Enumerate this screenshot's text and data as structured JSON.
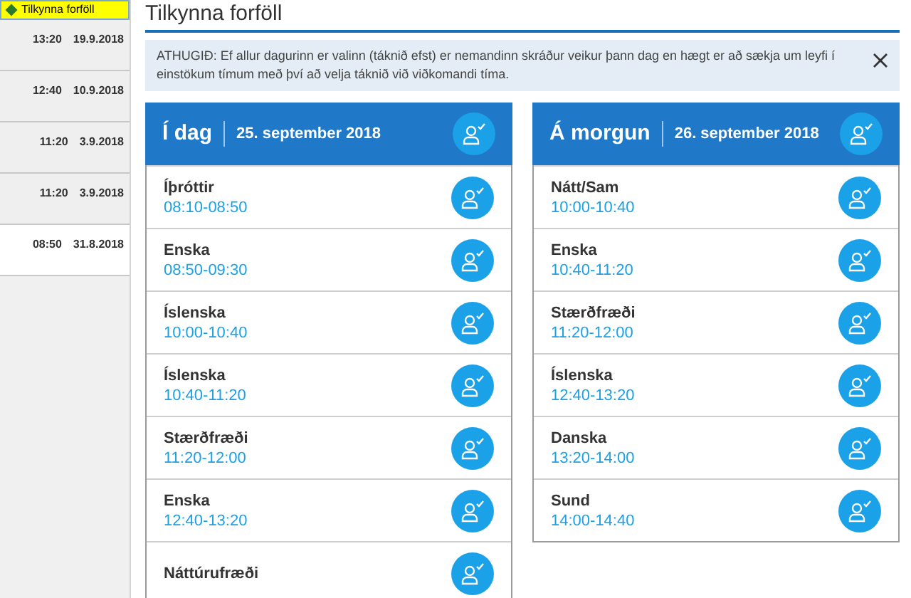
{
  "sidebar": {
    "active_item": "Tilkynna forföll",
    "items": [
      {
        "time": "13:20",
        "date": "19.9.2018",
        "highlighted": true
      },
      {
        "time": "12:40",
        "date": "10.9.2018",
        "highlighted": true
      },
      {
        "time": "11:20",
        "date": "3.9.2018",
        "highlighted": true
      },
      {
        "time": "11:20",
        "date": "3.9.2018",
        "highlighted": true
      },
      {
        "time": "08:50",
        "date": "31.8.2018",
        "highlighted": false
      }
    ]
  },
  "page_title": "Tilkynna forföll",
  "notice": {
    "text": "ATHUGIÐ: Ef allur dagurinn er valinn (táknið efst) er nemandinn skráður veikur þann dag en hægt er að sækja um leyfi í einstökum tímum með því að velja táknið við viðkomandi tíma."
  },
  "days": [
    {
      "label": "Í dag",
      "date": "25. september 2018",
      "classes": [
        {
          "subject": "Íþróttir",
          "time": "08:10-08:50"
        },
        {
          "subject": "Enska",
          "time": "08:50-09:30"
        },
        {
          "subject": "Íslenska",
          "time": "10:00-10:40"
        },
        {
          "subject": "Íslenska",
          "time": "10:40-11:20"
        },
        {
          "subject": "Stærðfræði",
          "time": "11:20-12:00"
        },
        {
          "subject": "Enska",
          "time": "12:40-13:20"
        },
        {
          "subject": "Náttúrufræði"
        }
      ]
    },
    {
      "label": "Á morgun",
      "date": "26. september 2018",
      "classes": [
        {
          "subject": "Nátt/Sam",
          "time": "10:00-10:40"
        },
        {
          "subject": "Enska",
          "time": "10:40-11:20"
        },
        {
          "subject": "Stærðfræði",
          "time": "11:20-12:00"
        },
        {
          "subject": "Íslenska",
          "time": "12:40-13:20"
        },
        {
          "subject": "Danska",
          "time": "13:20-14:00"
        },
        {
          "subject": "Sund",
          "time": "14:00-14:40"
        }
      ]
    }
  ]
}
